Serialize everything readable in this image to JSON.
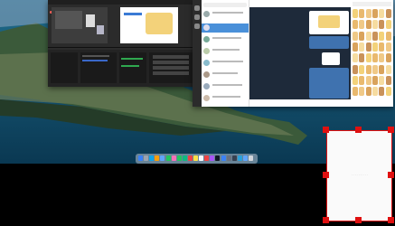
{
  "desktop": {
    "accent": "#e01010",
    "empty_bar_color": "#000000"
  },
  "obs_window": {
    "title_icon": "obs-icon",
    "dock_rows": [
      "",
      "",
      "",
      "",
      "",
      ""
    ]
  },
  "telegram_window": {
    "chats": [
      "",
      "",
      "",
      "",
      "",
      "",
      "",
      ""
    ],
    "sticker_rows": 8,
    "sticker_cols": 6
  },
  "dock": {
    "apps": [
      "finder-icon",
      "launchpad-icon",
      "safari-icon",
      "chrome-icon",
      "mail-icon",
      "maps-icon",
      "photos-icon",
      "messages-icon",
      "facetime-icon",
      "calendar-icon",
      "notes-icon",
      "reminders-icon",
      "music-icon",
      "podcasts-icon",
      "tv-icon",
      "appstore-icon",
      "settings-icon",
      "obs-icon",
      "telegram-icon",
      "preview-icon",
      "trash-icon"
    ]
  },
  "selected_window": {
    "caption": "· · · · · · · · · ·"
  }
}
